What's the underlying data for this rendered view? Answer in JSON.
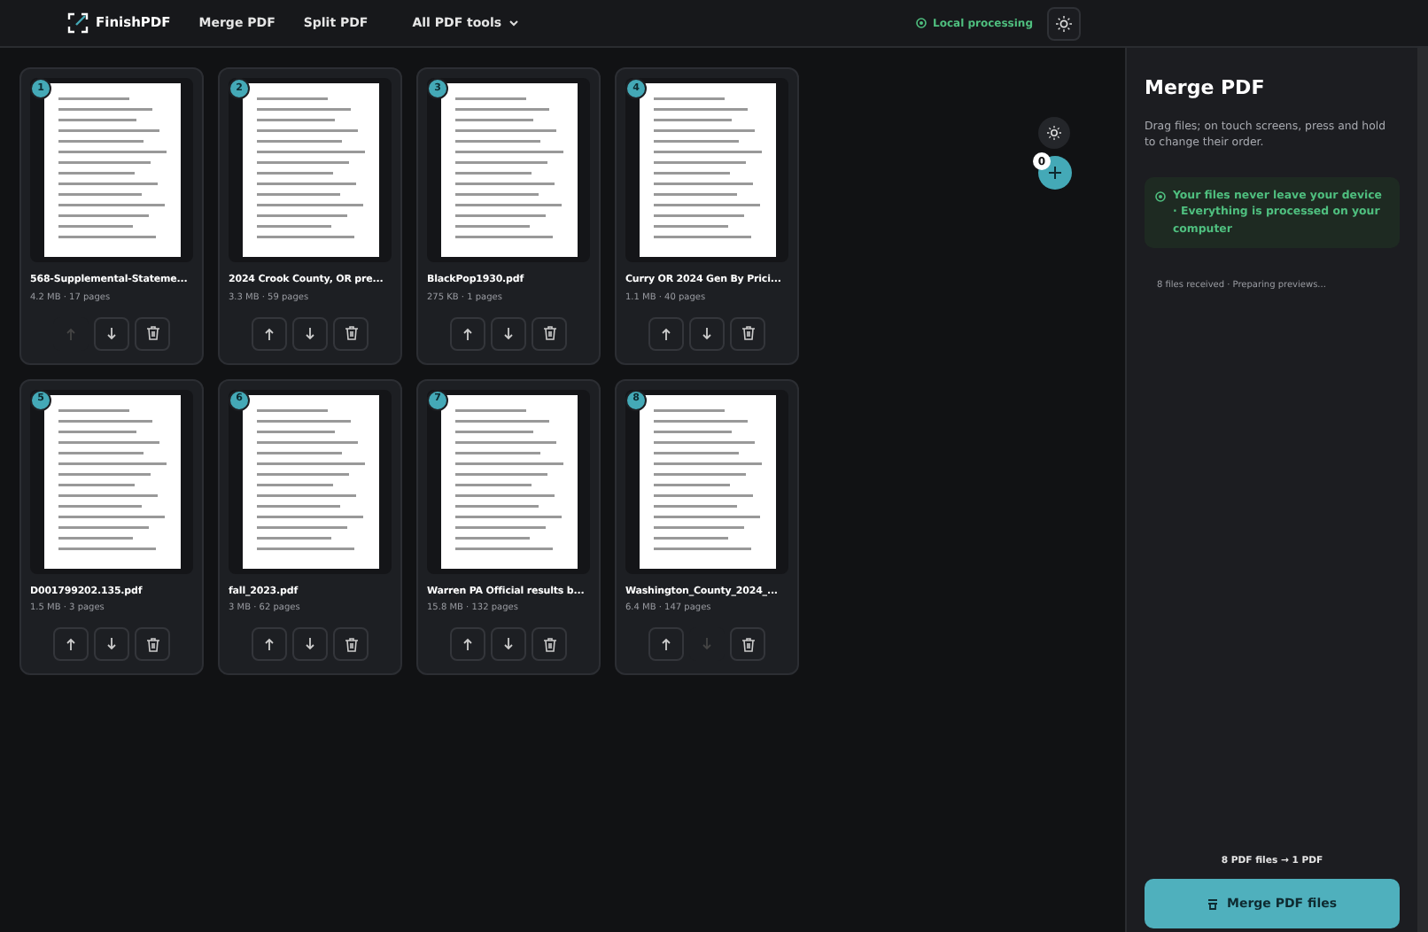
{
  "navbar": {
    "brand": "FinishPDF",
    "links": [
      "Merge PDF",
      "Split PDF"
    ],
    "dropdown": "All PDF tools",
    "status": "Local processing"
  },
  "files": [
    {
      "index": "1",
      "name": "568-Supplemental-Stateme...",
      "meta": "4.2 MB · 17 pages",
      "up_disabled": true,
      "down_disabled": false
    },
    {
      "index": "2",
      "name": "2024 Crook County, OR pre...",
      "meta": "3.3 MB · 59 pages",
      "up_disabled": false,
      "down_disabled": false
    },
    {
      "index": "3",
      "name": "BlackPop1930.pdf",
      "meta": "275 KB · 1 pages",
      "up_disabled": false,
      "down_disabled": false
    },
    {
      "index": "4",
      "name": "Curry OR 2024 Gen By Prici...",
      "meta": "1.1 MB · 40 pages",
      "up_disabled": false,
      "down_disabled": false
    },
    {
      "index": "5",
      "name": "D001799202.135.pdf",
      "meta": "1.5 MB · 3 pages",
      "up_disabled": false,
      "down_disabled": false
    },
    {
      "index": "6",
      "name": "fall_2023.pdf",
      "meta": "3 MB · 62 pages",
      "up_disabled": false,
      "down_disabled": false
    },
    {
      "index": "7",
      "name": "Warren PA Official results b...",
      "meta": "15.8 MB · 132 pages",
      "up_disabled": false,
      "down_disabled": false
    },
    {
      "index": "8",
      "name": "Washington_County_2024_...",
      "meta": "6.4 MB · 147 pages",
      "up_disabled": false,
      "down_disabled": true
    }
  ],
  "add_button": {
    "badge": "0"
  },
  "sidebar": {
    "title": "Merge PDF",
    "description": "Drag files; on touch screens, press and hold to change their order.",
    "privacy_note": "Your files never leave your device · Everything is processed on your computer",
    "progress": "8 files received · Preparing previews...",
    "summary": "8 PDF files → 1 PDF",
    "merge_button": "Merge PDF files"
  }
}
